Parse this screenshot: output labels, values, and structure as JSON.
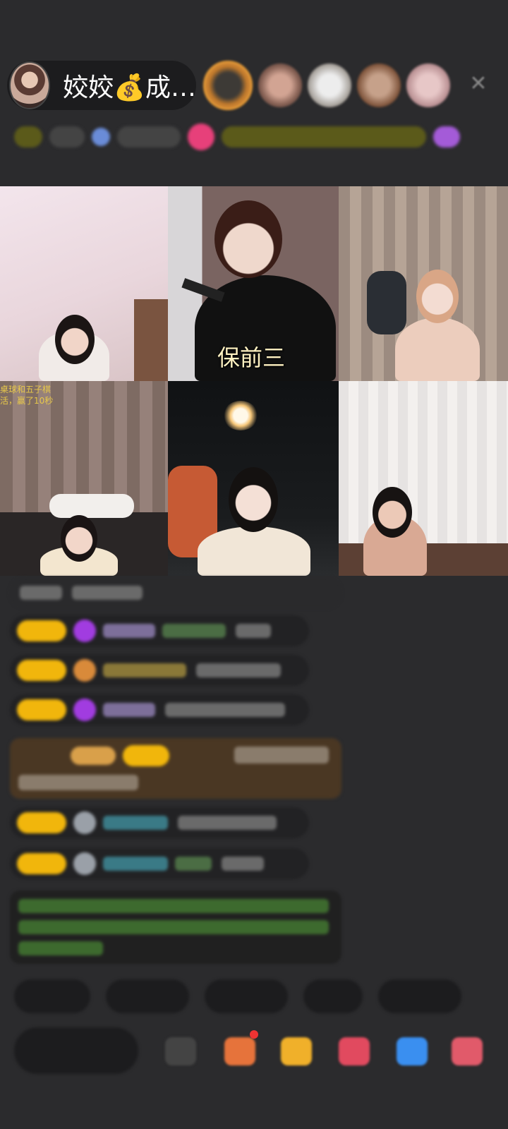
{
  "host": {
    "name": "姣姣💰成…"
  },
  "top_viewers": [
    {
      "name": "viewer-1"
    },
    {
      "name": "viewer-2"
    },
    {
      "name": "viewer-3"
    },
    {
      "name": "viewer-4"
    },
    {
      "name": "viewer-5"
    }
  ],
  "video_grid": {
    "subtitle": "保前三",
    "cell4_note_line1": "桌球和五子棋",
    "cell4_note_line2": "活，赢了10秒"
  },
  "colors": {
    "background": "#2b2b2d",
    "pill": "#1c1c1e",
    "badge_gold": "#f1b60c",
    "subtitle": "#fff2c2",
    "accent_pink": "#e7407a"
  },
  "icons": {
    "close": "close-icon",
    "gift": "gift-icon",
    "share": "share-icon",
    "more": "more-icon"
  }
}
